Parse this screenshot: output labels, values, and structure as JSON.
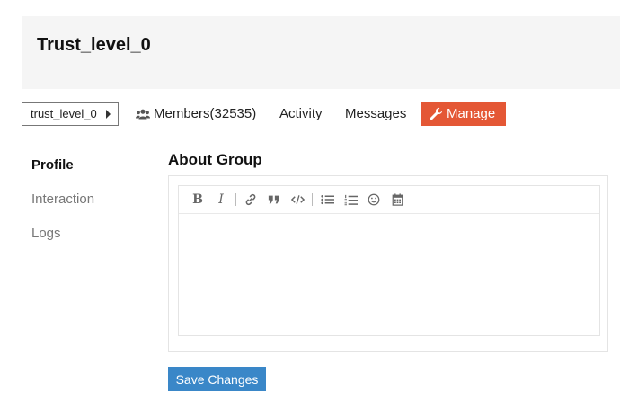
{
  "header": {
    "title": "Trust_level_0"
  },
  "nav": {
    "group_selector": "trust_level_0",
    "members": "Members(32535)",
    "activity": "Activity",
    "messages": "Messages",
    "manage": "Manage"
  },
  "sidebar": {
    "items": [
      {
        "label": "Profile",
        "active": true
      },
      {
        "label": "Interaction",
        "active": false
      },
      {
        "label": "Logs",
        "active": false
      }
    ]
  },
  "main": {
    "section_title": "About Group",
    "editor": {
      "toolbar": [
        "bold-icon",
        "italic-icon",
        "link-icon",
        "quote-icon",
        "code-icon",
        "bullet-list-icon",
        "numbered-list-icon",
        "emoji-icon",
        "calendar-icon"
      ],
      "bold_label": "B",
      "italic_label": "I",
      "value": ""
    },
    "save_label": "Save Changes"
  },
  "colors": {
    "manage_bg": "#e45735",
    "save_bg": "#3a87c8",
    "header_bg": "#f5f5f5"
  }
}
